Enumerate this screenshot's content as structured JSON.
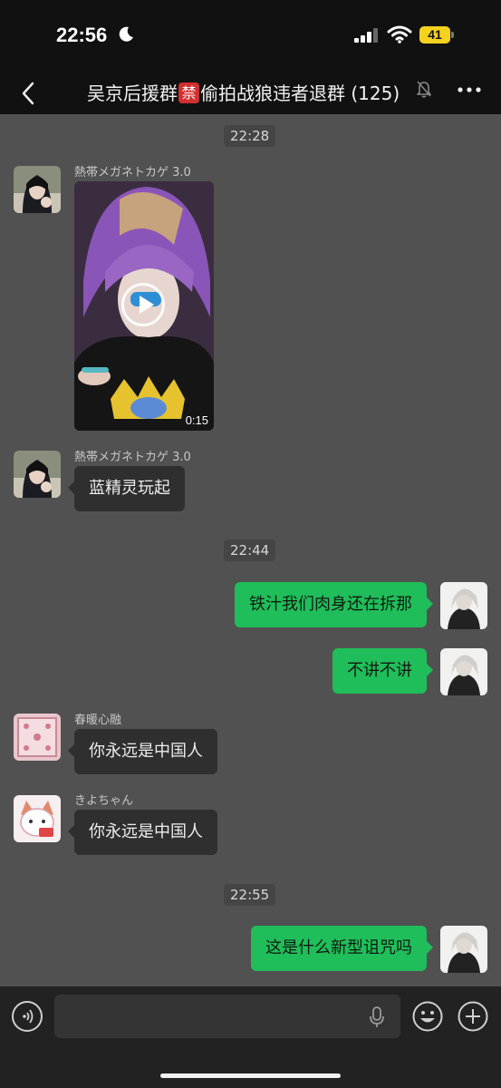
{
  "status": {
    "time": "22:56",
    "battery": "41"
  },
  "header": {
    "title_before": "吴京后援群",
    "forbid_char": "禁",
    "title_after": "偷拍战狼违者退群 (125)"
  },
  "messages": {
    "t1": "22:28",
    "sender_gecko": "熱帯メガネトカゲ 3.0",
    "video_duration": "0:15",
    "msg_blue_elf": "蓝精灵玩起",
    "t2": "22:44",
    "msg_tiezhi": "铁汁我们肉身还在拆那",
    "msg_bujiang": "不讲不讲",
    "sender_chunnuan": "春暖心融",
    "msg_chinese1": "你永远是中国人",
    "sender_kiyo": "きよちゃん",
    "msg_chinese2": "你永远是中国人",
    "t3": "22:55",
    "msg_curse": "这是什么新型诅咒吗"
  },
  "colors": {
    "chat_background": "#515151",
    "my_bubble": "#1fbe5a",
    "other_bubble": "#2f2f2f",
    "forbid_badge": "#d32f2f"
  },
  "icons": [
    "moon-icon",
    "signal-icon",
    "wifi-icon",
    "back-icon",
    "mute-icon",
    "more-icon",
    "play-icon",
    "voice-icon",
    "mic-icon",
    "emoji-icon",
    "plus-icon"
  ]
}
